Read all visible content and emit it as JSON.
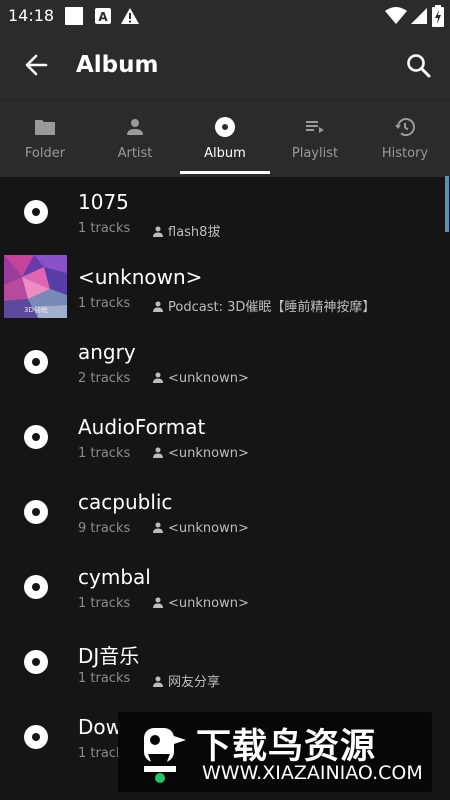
{
  "status_bar": {
    "time": "14:18"
  },
  "header": {
    "title": "Album"
  },
  "tabs": [
    {
      "label": "Folder",
      "icon": "folder-icon",
      "active": false
    },
    {
      "label": "Artist",
      "icon": "person-icon",
      "active": false
    },
    {
      "label": "Album",
      "icon": "disc-icon",
      "active": true
    },
    {
      "label": "Playlist",
      "icon": "playlist-icon",
      "active": false
    },
    {
      "label": "History",
      "icon": "history-icon",
      "active": false
    }
  ],
  "albums": [
    {
      "title": "1075",
      "tracks": "1 tracks",
      "artist": "flash8拔",
      "art": "disc"
    },
    {
      "title": "<unknown>",
      "tracks": "1 tracks",
      "artist": "Podcast: 3D催眠【睡前精神按摩】",
      "art": "thumbnail",
      "art_caption": "3D催眠"
    },
    {
      "title": "angry",
      "tracks": "2 tracks",
      "artist": "<unknown>",
      "art": "disc"
    },
    {
      "title": "AudioFormat",
      "tracks": "1 tracks",
      "artist": "<unknown>",
      "art": "disc"
    },
    {
      "title": "cacpublic",
      "tracks": "9 tracks",
      "artist": "<unknown>",
      "art": "disc"
    },
    {
      "title": "cymbal",
      "tracks": "1 tracks",
      "artist": "<unknown>",
      "art": "disc"
    },
    {
      "title": "DJ音乐",
      "tracks": "1 tracks",
      "artist": "网友分享",
      "art": "disc"
    },
    {
      "title": "Dow",
      "tracks": "1 track",
      "artist": "",
      "art": "disc"
    }
  ],
  "watermark": {
    "title": "下载鸟资源",
    "url": "WWW.XIAZAINIAO.COM"
  },
  "colors": {
    "background": "#151515",
    "bar": "#2b2b2b",
    "accent": "#ffffff",
    "scrollbar": "#5a8fb5"
  }
}
